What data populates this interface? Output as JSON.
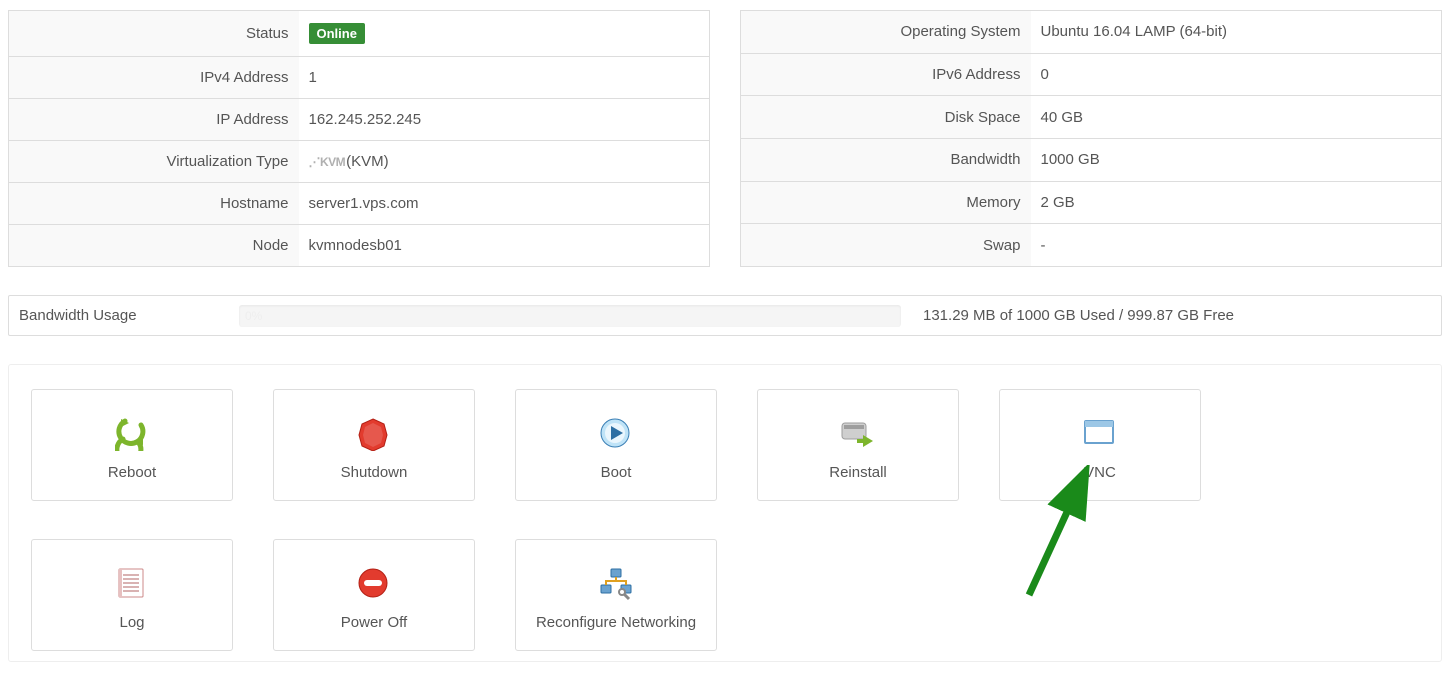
{
  "left_table": [
    {
      "label": "Status",
      "value": "Online",
      "is_status": true
    },
    {
      "label": "IPv4 Address",
      "value": "1"
    },
    {
      "label": "IP Address",
      "value": "162.245.252.245"
    },
    {
      "label": "Virtualization Type",
      "value": "(KVM)",
      "has_kvm_logo": true
    },
    {
      "label": "Hostname",
      "value": "server1.vps.com"
    },
    {
      "label": "Node",
      "value": "kvmnodesb01"
    }
  ],
  "right_table": [
    {
      "label": "Operating System",
      "value": "Ubuntu 16.04 LAMP (64-bit)"
    },
    {
      "label": "IPv6 Address",
      "value": "0"
    },
    {
      "label": "Disk Space",
      "value": "40 GB"
    },
    {
      "label": "Bandwidth",
      "value": "1000 GB"
    },
    {
      "label": "Memory",
      "value": "2 GB"
    },
    {
      "label": "Swap",
      "value": "-"
    }
  ],
  "bandwidth": {
    "label": "Bandwidth Usage",
    "percent_text": "0%",
    "summary": "131.29 MB of 1000 GB Used / 999.87 GB Free"
  },
  "actions": [
    {
      "key": "reboot",
      "label": "Reboot",
      "icon": "reboot"
    },
    {
      "key": "shutdown",
      "label": "Shutdown",
      "icon": "shutdown"
    },
    {
      "key": "boot",
      "label": "Boot",
      "icon": "boot"
    },
    {
      "key": "reinstall",
      "label": "Reinstall",
      "icon": "reinstall"
    },
    {
      "key": "vnc",
      "label": "VNC",
      "icon": "vnc"
    },
    {
      "key": "log",
      "label": "Log",
      "icon": "log"
    },
    {
      "key": "poweroff",
      "label": "Power Off",
      "icon": "poweroff"
    },
    {
      "key": "reconfigure-networking",
      "label": "Reconfigure Networking",
      "icon": "reconfigure-networking"
    }
  ],
  "colors": {
    "status_badge": "#368e36",
    "arrow": "#2a8a2a"
  }
}
